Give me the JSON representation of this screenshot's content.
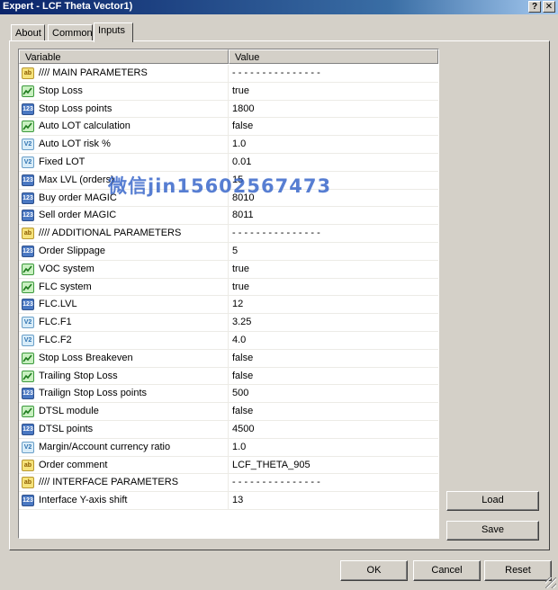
{
  "window": {
    "title": "Expert - LCF Theta Vector1)",
    "help_glyph": "?",
    "close_glyph": "✕"
  },
  "tabs": [
    {
      "label": "About"
    },
    {
      "label": "Common"
    },
    {
      "label": "Inputs"
    }
  ],
  "grid": {
    "col_variable": "Variable",
    "col_value": "Value",
    "rows": [
      {
        "icon": "string",
        "name": "//// MAIN PARAMETERS",
        "value": "- - - - - - - - - - - - - - -"
      },
      {
        "icon": "bool",
        "name": "Stop Loss",
        "value": "true"
      },
      {
        "icon": "int",
        "name": "Stop Loss points",
        "value": "1800"
      },
      {
        "icon": "bool",
        "name": "Auto LOT calculation",
        "value": "false"
      },
      {
        "icon": "double",
        "name": "Auto LOT risk %",
        "value": "1.0"
      },
      {
        "icon": "double",
        "name": "Fixed LOT",
        "value": "0.01"
      },
      {
        "icon": "int",
        "name": "Max LVL (orders)",
        "value": "15"
      },
      {
        "icon": "int",
        "name": "Buy order MAGIC",
        "value": "8010"
      },
      {
        "icon": "int",
        "name": "Sell order MAGIC",
        "value": "8011"
      },
      {
        "icon": "string",
        "name": "//// ADDITIONAL PARAMETERS",
        "value": "- - - - - - - - - - - - - - -"
      },
      {
        "icon": "int",
        "name": "Order Slippage",
        "value": "5"
      },
      {
        "icon": "bool",
        "name": "VOC system",
        "value": "true"
      },
      {
        "icon": "bool",
        "name": "FLC system",
        "value": "true"
      },
      {
        "icon": "int",
        "name": "FLC.LVL",
        "value": "12"
      },
      {
        "icon": "double",
        "name": "FLC.F1",
        "value": "3.25"
      },
      {
        "icon": "double",
        "name": "FLC.F2",
        "value": "4.0"
      },
      {
        "icon": "bool",
        "name": "Stop Loss Breakeven",
        "value": "false"
      },
      {
        "icon": "bool",
        "name": "Trailing Stop Loss",
        "value": "false"
      },
      {
        "icon": "int",
        "name": "Trailign Stop Loss points",
        "value": "500"
      },
      {
        "icon": "bool",
        "name": "DTSL module",
        "value": "false"
      },
      {
        "icon": "int",
        "name": "DTSL points",
        "value": "4500"
      },
      {
        "icon": "double",
        "name": "Margin/Account currency ratio",
        "value": "1.0"
      },
      {
        "icon": "string",
        "name": "Order comment",
        "value": "LCF_THETA_905"
      },
      {
        "icon": "string",
        "name": "//// INTERFACE PARAMETERS",
        "value": "- - - - - - - - - - - - - - -"
      },
      {
        "icon": "int",
        "name": "Interface Y-axis shift",
        "value": "13"
      }
    ]
  },
  "icon_glyphs": {
    "string": "ab",
    "int": "123",
    "double": "V2",
    "bool": ""
  },
  "side_buttons": {
    "load": "Load",
    "save": "Save"
  },
  "bottom_buttons": {
    "ok": "OK",
    "cancel": "Cancel",
    "reset": "Reset"
  },
  "watermark": "微信jin15602567473"
}
